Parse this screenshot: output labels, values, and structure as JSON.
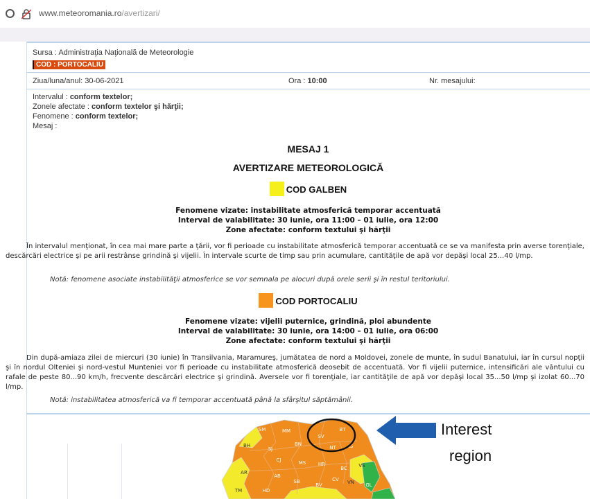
{
  "browser": {
    "url_domain": "www.meteoromania.ro",
    "url_path": "/avertizari/"
  },
  "header": {
    "source_label": "Sursa :",
    "source_value": "Administraţia Naţională de Meteorologie",
    "badge": "COD : PORTOCALIU"
  },
  "meta": {
    "date_label": "Ziua/luna/anul:",
    "date_value": "30-06-2021",
    "time_label": "Ora :",
    "time_value": "10:00",
    "msgno_label": "Nr. mesajului:"
  },
  "info": {
    "interval_label": "Intervalul :",
    "interval_value": "conform textelor;",
    "zones_label": "Zonele afectate :",
    "zones_value": "conform textelor şi hărţii;",
    "phen_label": "Fenomene :",
    "phen_value": "conform textelor;",
    "msg_label": "Mesaj :"
  },
  "message": {
    "title": "MESAJ 1",
    "subtitle": "AVERTIZARE METEOROLOGICĂ"
  },
  "yellow": {
    "code": "COD GALBEN",
    "color": "#f5ef1a",
    "line1": "Fenomene vizate: instabilitate atmosferică temporar accentuată",
    "line2": "Interval de valabilitate: 30 iunie, ora 11:00 – 01 iulie, ora 12:00",
    "line3": "Zone afectate: conform textului şi hărţii",
    "paragraph": "În intervalul menţionat, în cea mai mare parte a ţării, vor fi perioade cu instabilitate atmosferică temporar accentuată ce se va manifesta prin averse torenţiale, descărcări electrice şi pe arii restrânse grindină şi vijelii. În intervale scurte de timp sau prin acumulare, cantităţile de apă vor depăşi local 25...40 l/mp.",
    "note": "Notă: fenomene asociate instabilităţii atmosferice se vor semnala pe alocuri după orele serii şi în restul teritoriului."
  },
  "orange": {
    "code": "COD PORTOCALIU",
    "color": "#f7941d",
    "line1": "Fenomene vizate: vijelii puternice, grindină, ploi abundente",
    "line2": "Interval de valabilitate: 30 iunie, ora 14:00 – 01 iulie, ora 06:00",
    "line3": "Zone afectate: conform textului şi hărţii",
    "paragraph": "Din după-amiaza zilei de miercuri (30 iunie) în Transilvania, Maramureş, jumătatea de nord a Moldovei, zonele de munte, în sudul Banatului, iar în cursul nopţii şi în nordul Olteniei şi nord-vestul Munteniei vor fi perioade cu instabilitate atmosferică deosebit de accentuată. Vor fi vijelii puternice, intensificări ale vântului cu rafale de peste 80...90 km/h, frecvente descărcări electrice şi grindină. Aversele vor fi torenţiale, iar cantităţile de apă vor depăşi local 35...50 l/mp şi izolat 60...70 l/mp.",
    "note": "Notă: instabilitatea atmosferică va fi temporar accentuată până la sfârşitul săptămânii."
  },
  "map": {
    "labels": [
      "SM",
      "MM",
      "SV",
      "BT",
      "BH",
      "SJ",
      "BN",
      "IS",
      "NT",
      "CJ",
      "MS",
      "HR",
      "BC",
      "VS",
      "AR",
      "AB",
      "SB",
      "BV",
      "CV",
      "VN",
      "GL",
      "TM",
      "HD"
    ],
    "orange": "#f08c1e",
    "yellow": "#f2ea2a",
    "green": "#32b34a"
  },
  "annotation": {
    "line1": "Interest",
    "line2": "region",
    "arrow_color": "#1f5fae"
  }
}
